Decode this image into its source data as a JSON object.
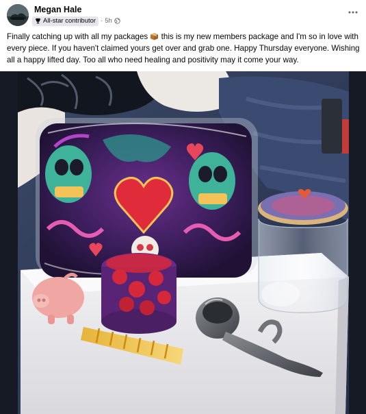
{
  "post": {
    "author": "Megan Hale",
    "badge": "All-star contributor",
    "separator": "·",
    "time": "5h",
    "audience_icon": "globe-icon",
    "more_icon": "more-options-icon",
    "text_before_emoji": "Finally catching up with all my packages ",
    "emoji": "package-emoji",
    "text_after_emoji": " this is my new members package and I'm so in love with every piece. If you haven't claimed yours get over and grab one. Happy Thursday everyone. Wishing all a happy lifted day. Too all who need healing and positivity may it come your way."
  },
  "colors": {
    "text_primary": "#050505",
    "text_secondary": "#65676b",
    "badge_bg": "#e4e6eb"
  }
}
